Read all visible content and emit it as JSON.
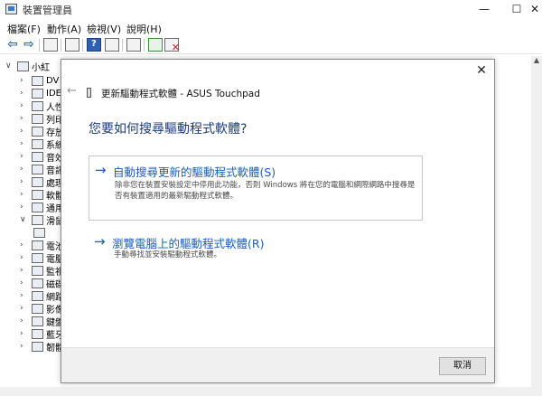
{
  "window": {
    "title": "裝置管理員",
    "minimize": "—",
    "maximize": "☐",
    "close": "✕"
  },
  "menu": {
    "items": [
      {
        "label": "檔案(F)"
      },
      {
        "label": "動作(A)"
      },
      {
        "label": "檢視(V)"
      },
      {
        "label": "說明(H)"
      }
    ]
  },
  "toolbar": {
    "icons": [
      "back-icon",
      "forward-icon",
      "properties-icon",
      "view-icon",
      "help-icon",
      "show-hidden-icon",
      "scan-hardware-icon",
      "update-driver-icon",
      "uninstall-icon"
    ]
  },
  "tree": {
    "root_label": "小紅",
    "items": [
      {
        "label": "DV",
        "expanded": false
      },
      {
        "label": "IDE",
        "expanded": false
      },
      {
        "label": "人性",
        "expanded": false
      },
      {
        "label": "列印",
        "expanded": false
      },
      {
        "label": "存放",
        "expanded": false
      },
      {
        "label": "系統",
        "expanded": false
      },
      {
        "label": "音效",
        "expanded": false
      },
      {
        "label": "音訊",
        "expanded": false
      },
      {
        "label": "處理",
        "expanded": false
      },
      {
        "label": "軟體",
        "expanded": false
      },
      {
        "label": "通用",
        "expanded": false
      },
      {
        "label": "滑鼠",
        "expanded": true
      },
      {
        "label": "",
        "expanded": false,
        "child": true
      },
      {
        "label": "電池",
        "expanded": false
      },
      {
        "label": "電腦",
        "expanded": false
      },
      {
        "label": "監視",
        "expanded": false
      },
      {
        "label": "磁碟",
        "expanded": false
      },
      {
        "label": "網路",
        "expanded": false
      },
      {
        "label": "影像",
        "expanded": false
      },
      {
        "label": "鍵盤",
        "expanded": false
      },
      {
        "label": "藍牙",
        "expanded": false
      },
      {
        "label": "韌體",
        "expanded": false
      }
    ]
  },
  "dialog": {
    "back_arrow": "←",
    "close": "✕",
    "header": "更新驅動程式軟體 - ASUS Touchpad",
    "question": "您要如何搜尋驅動程式軟體?",
    "option_auto": {
      "arrow": "→",
      "title": "自動搜尋更新的驅動程式軟體(S)",
      "description": "除非您在裝置安裝設定中停用此功能，否則 Windows 將在您的電腦和網際網路中搜尋是否有裝置適用的最新驅動程式軟體。"
    },
    "option_browse": {
      "arrow": "→",
      "title": "瀏覽電腦上的驅動程式軟體(R)",
      "description": "手動尋找並安裝驅動程式軟體。"
    },
    "cancel_label": "取消"
  }
}
